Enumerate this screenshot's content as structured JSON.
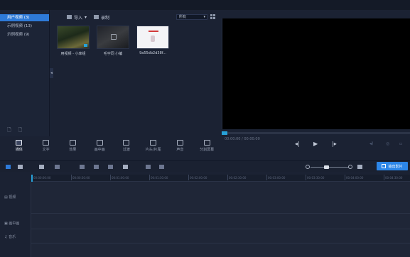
{
  "library": {
    "items": [
      {
        "label": "用户视频 (3)",
        "active": true
      },
      {
        "label": "示例视频 (13)",
        "active": false
      },
      {
        "label": "示例视频 (9)",
        "active": false
      }
    ],
    "bottom_icons": [
      "add-folder-icon",
      "delete-folder-icon"
    ]
  },
  "media_toolbar": {
    "import_label": "导入",
    "record_label": "录制",
    "sort_value": "所有"
  },
  "thumbnails": [
    {
      "caption": "用视频 - 小率组",
      "icon": "video-thumbnail"
    },
    {
      "caption": "毛宇同 小编",
      "icon": "video-thumbnail"
    },
    {
      "caption": "9a55db2d38f...",
      "icon": "image-thumbnail"
    }
  ],
  "preview": {
    "timecode": "00:00:00 / 00:00:00"
  },
  "function_tabs": [
    {
      "label": "媒体",
      "icon": "media-icon",
      "active": true
    },
    {
      "label": "文字",
      "icon": "text-icon",
      "active": false
    },
    {
      "label": "效果",
      "icon": "effects-icon",
      "active": false
    },
    {
      "label": "画中画",
      "icon": "pip-icon",
      "active": false
    },
    {
      "label": "过渡",
      "icon": "transition-icon",
      "active": false
    },
    {
      "label": "片头/片尾",
      "icon": "intro-outro-icon",
      "active": false
    },
    {
      "label": "声音",
      "icon": "audio-icon",
      "active": false
    },
    {
      "label": "分割屏幕",
      "icon": "split-screen-icon",
      "active": false
    }
  ],
  "timeline": {
    "export_label": "输出影片",
    "ruler_ticks": [
      "00:00:00:00",
      "00:00:30:00",
      "00:01:00:00",
      "00:01:30:00",
      "00:02:00:00",
      "00:02:30:00",
      "00:03:00:00",
      "00:03:30:00",
      "00:04:00:00",
      "00:04:30:00"
    ],
    "tracks": [
      {
        "label": "视频",
        "icon": "video-track-icon"
      },
      {
        "label": "画中画",
        "icon": "pip-track-icon"
      },
      {
        "label": "音乐",
        "icon": "music-track-icon"
      }
    ]
  },
  "colors": {
    "accent": "#2e7ad8",
    "playhead": "#27a2d9",
    "background": "#1b2233"
  }
}
